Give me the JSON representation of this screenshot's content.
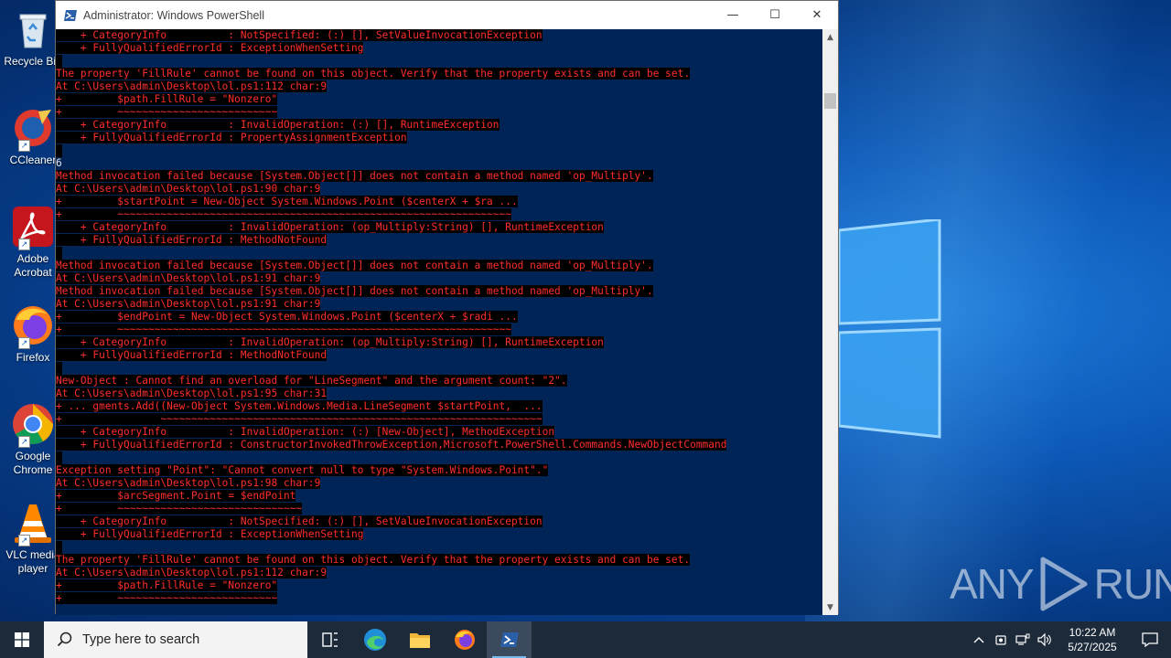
{
  "window": {
    "title": "Administrator: Windows PowerShell",
    "minimize_glyph": "—",
    "maximize_glyph": "☐",
    "close_glyph": "✕"
  },
  "console_lines": [
    "    + CategoryInfo          : NotSpecified: (:) [], SetValueInvocationException",
    "    + FullyQualifiedErrorId : ExceptionWhenSetting",
    "",
    "The property 'FillRule' cannot be found on this object. Verify that the property exists and can be set.",
    "At C:\\Users\\admin\\Desktop\\lol.ps1:112 char:9",
    "+         $path.FillRule = \"Nonzero\"",
    "+         ~~~~~~~~~~~~~~~~~~~~~~~~~~",
    "    + CategoryInfo          : InvalidOperation: (:) [], RuntimeException",
    "    + FullyQualifiedErrorId : PropertyAssignmentException",
    "",
    "",
    "Method invocation failed because [System.Object[]] does not contain a method named 'op_Multiply'.",
    "At C:\\Users\\admin\\Desktop\\lol.ps1:90 char:9",
    "+         $startPoint = New-Object System.Windows.Point ($centerX + $ra ...",
    "+         ~~~~~~~~~~~~~~~~~~~~~~~~~~~~~~~~~~~~~~~~~~~~~~~~~~~~~~~~~~~~~~~~",
    "    + CategoryInfo          : InvalidOperation: (op_Multiply:String) [], RuntimeException",
    "    + FullyQualifiedErrorId : MethodNotFound",
    "",
    "Method invocation failed because [System.Object[]] does not contain a method named 'op_Multiply'.",
    "At C:\\Users\\admin\\Desktop\\lol.ps1:91 char:9",
    "Method invocation failed because [System.Object[]] does not contain a method named 'op_Multiply'.",
    "At C:\\Users\\admin\\Desktop\\lol.ps1:91 char:9",
    "+         $endPoint = New-Object System.Windows.Point ($centerX + $radi ...",
    "+         ~~~~~~~~~~~~~~~~~~~~~~~~~~~~~~~~~~~~~~~~~~~~~~~~~~~~~~~~~~~~~~~~",
    "    + CategoryInfo          : InvalidOperation: (op_Multiply:String) [], RuntimeException",
    "    + FullyQualifiedErrorId : MethodNotFound",
    "",
    "New-Object : Cannot find an overload for \"LineSegment\" and the argument count: \"2\".",
    "At C:\\Users\\admin\\Desktop\\lol.ps1:95 char:31",
    "+ ... gments.Add((New-Object System.Windows.Media.LineSegment $startPoint,  ...",
    "+                ~~~~~~~~~~~~~~~~~~~~~~~~~~~~~~~~~~~~~~~~~~~~~~~~~~~~~~~~~~~~~~",
    "    + CategoryInfo          : InvalidOperation: (:) [New-Object], MethodException",
    "    + FullyQualifiedErrorId : ConstructorInvokedThrowException,Microsoft.PowerShell.Commands.NewObjectCommand",
    "",
    "Exception setting \"Point\": \"Cannot convert null to type \"System.Windows.Point\".\"",
    "At C:\\Users\\admin\\Desktop\\lol.ps1:98 char:9",
    "+         $arcSegment.Point = $endPoint",
    "+         ~~~~~~~~~~~~~~~~~~~~~~~~~~~~~~",
    "    + CategoryInfo          : NotSpecified: (:) [], SetValueInvocationException",
    "    + FullyQualifiedErrorId : ExceptionWhenSetting",
    "",
    "The property 'FillRule' cannot be found on this object. Verify that the property exists and can be set.",
    "At C:\\Users\\admin\\Desktop\\lol.ps1:112 char:9",
    "+         $path.FillRule = \"Nonzero\"",
    "+         ~~~~~~~~~~~~~~~~~~~~~~~~~~"
  ],
  "stray_text": "6",
  "desktop_icons": [
    {
      "label": "Recycle Bin",
      "icon": "recycle-bin-icon"
    },
    {
      "label": "CCleaner",
      "icon": "ccleaner-icon"
    },
    {
      "label": "Adobe Acrobat",
      "icon": "adobe-acrobat-icon"
    },
    {
      "label": "Firefox",
      "icon": "firefox-icon"
    },
    {
      "label": "Google Chrome",
      "icon": "chrome-icon"
    },
    {
      "label": "VLC media player",
      "icon": "vlc-icon"
    }
  ],
  "taskbar": {
    "search_placeholder": "Type here to search",
    "apps": [
      "task-view-icon",
      "edge-icon",
      "file-explorer-icon",
      "firefox-icon",
      "powershell-icon"
    ],
    "time": "10:22 AM",
    "date": "5/27/2025"
  },
  "watermark": {
    "left": "ANY",
    "right": "RUN"
  },
  "colors": {
    "console_bg": "#012456",
    "error_text": "#ff2e2e",
    "error_bg": "#000000",
    "taskbar_bg": "#1c2a3a"
  }
}
